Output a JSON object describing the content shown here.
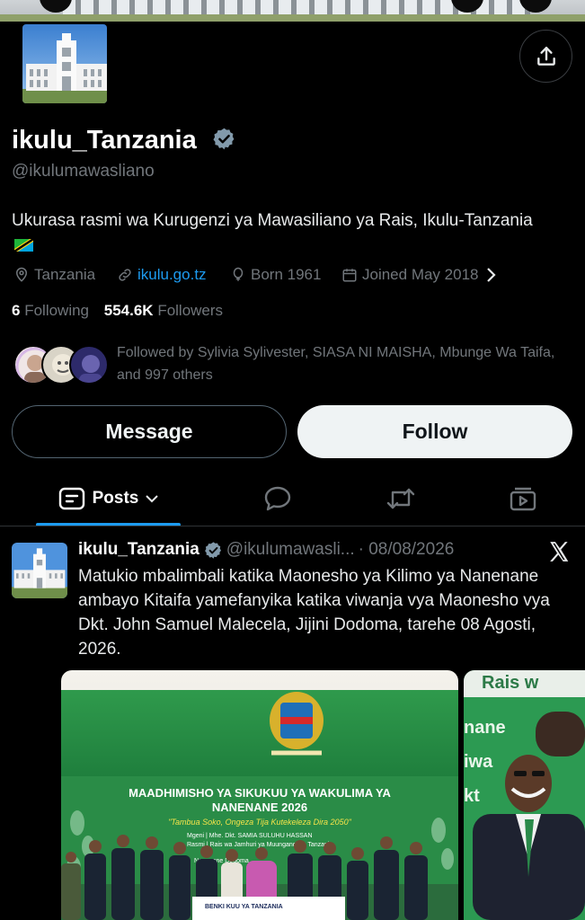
{
  "profile": {
    "display_name": "ikulu_Tanzania",
    "handle": "@ikulumawasliano",
    "bio": "Ukurasa rasmi wa Kurugenzi ya Mawasiliano ya Rais, Ikulu-Tanzania",
    "location": "Tanzania",
    "website": "ikulu.go.tz",
    "born": "Born 1961",
    "joined": "Joined May 2018",
    "following_count": "6",
    "following_label": "Following",
    "followers_count": "554.6K",
    "followers_label": "Followers",
    "followed_by": "Followed by Sylivia Sylivester, SIASA NI MAISHA, Mbunge Wa Taifa, and 997 others"
  },
  "buttons": {
    "message": "Message",
    "follow": "Follow"
  },
  "tabs": {
    "posts": "Posts"
  },
  "post": {
    "author": "ikulu_Tanzania",
    "handle": "@ikulumawasli...",
    "date": "· 08/08/2026",
    "text": "Matukio mbalimbali katika Maonesho ya Kilimo ya Nanenane ambayo Kitaifa yamefanyika katika viwanja vya Maonesho vya Dkt. John Samuel Malecela, Jijini Dodoma, tarehe 08 Agosti, 2026.",
    "image_banner_title": "MAADHIMISHO YA SIKUKUU YA WAKULIMA YA NANENANE 2026",
    "image_banner_slogan": "\"Tambua Soko, Ongeza Tija Kutekeleza Dira 2050\"",
    "image_banner_guest": "Mgeni Rasmi | Mhe. Dkt. SAMIA SULUHU HASSAN, Rais wa Jamhuri ya Muungano wa Tanzania",
    "image_banner_venue": "Nanenane Dodoma Viwanja vya Dkt. J.S. Malecela",
    "image_bank_label": "BENKI KUU YA TANZANIA",
    "image_side_text": "Rais w... nane... iwa... kt"
  },
  "icons": {
    "share": "share-icon",
    "verified": "verified-badge-icon",
    "location": "location-pin-icon",
    "link": "link-icon",
    "birthday": "balloon-icon",
    "joined": "calendar-icon",
    "chevron": "chevron-right-icon",
    "posts_tab": "posts-tab-icon",
    "replies_tab": "speech-bubble-icon",
    "reposts_tab": "repost-icon",
    "media_tab": "media-icon",
    "grok": "x-logo-icon"
  },
  "colors": {
    "background": "#000000",
    "accent": "#1d9bf0",
    "muted_text": "#71767b",
    "primary_text": "#e7e9ea",
    "follow_button_bg": "#eff3f4"
  }
}
